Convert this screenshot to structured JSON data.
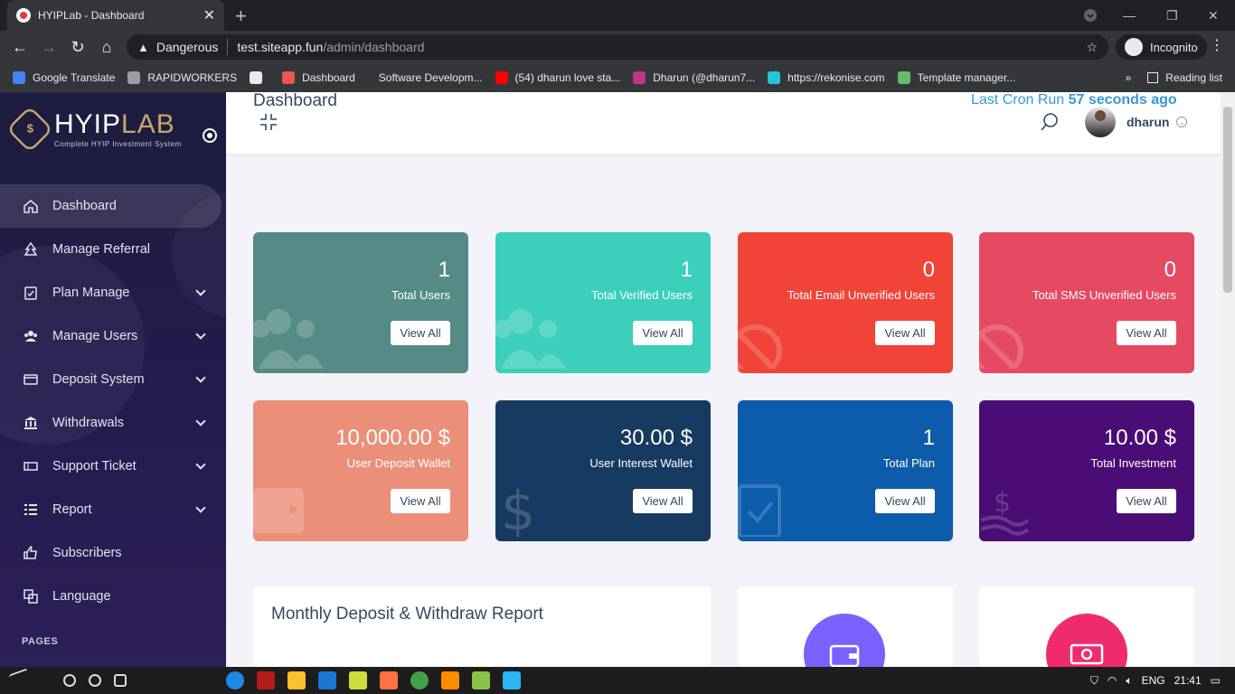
{
  "browser": {
    "tab_title": "HYIPLab - Dashboard",
    "security_label": "Dangerous",
    "url_host": "test.siteapp.fun",
    "url_path": "/admin/dashboard",
    "incognito_label": "Incognito",
    "bookmarks": [
      {
        "label": "Google Translate",
        "color": "#4285f4"
      },
      {
        "label": "RAPIDWORKERS",
        "color": "#9aa0a6"
      },
      {
        "label": "",
        "color": "#e8eaed"
      },
      {
        "label": "Dashboard",
        "color": "#ef5350"
      },
      {
        "label": "Software Developm...",
        "color": ""
      },
      {
        "label": "(54) dharun love sta...",
        "color": "#ff0000"
      },
      {
        "label": "Dharun (@dharun7...",
        "color": "#c13584"
      },
      {
        "label": "https://rekonise.com",
        "color": "#26c6da"
      },
      {
        "label": "Template manager...",
        "color": "#66bb6a"
      }
    ],
    "reading_list_label": "Reading list",
    "more_bookmarks": "»"
  },
  "sidebar": {
    "brand_main": "HYIP",
    "brand_accent": "LAB",
    "brand_tagline": "Complete HYIP Investment System",
    "items": [
      {
        "label": "Dashboard",
        "icon": "home-icon",
        "active": true,
        "has_children": false
      },
      {
        "label": "Manage Referral",
        "icon": "referral-tree-icon",
        "active": false,
        "has_children": false
      },
      {
        "label": "Plan Manage",
        "icon": "clipboard-check-icon",
        "active": false,
        "has_children": true
      },
      {
        "label": "Manage Users",
        "icon": "users-icon",
        "active": false,
        "has_children": true
      },
      {
        "label": "Deposit System",
        "icon": "credit-card-icon",
        "active": false,
        "has_children": true
      },
      {
        "label": "Withdrawals",
        "icon": "bank-icon",
        "active": false,
        "has_children": true
      },
      {
        "label": "Support Ticket",
        "icon": "ticket-icon",
        "active": false,
        "has_children": true
      },
      {
        "label": "Report",
        "icon": "list-icon",
        "active": false,
        "has_children": true
      },
      {
        "label": "Subscribers",
        "icon": "thumbs-up-icon",
        "active": false,
        "has_children": false
      },
      {
        "label": "Language",
        "icon": "language-icon",
        "active": false,
        "has_children": false
      }
    ],
    "section_label": "PAGES"
  },
  "topbar": {
    "username": "dharun"
  },
  "main": {
    "page_title": "Dashboard",
    "cron_label": "Last Cron Run",
    "cron_value": "57 seconds ago",
    "cards": [
      {
        "value": "1",
        "label": "Total Users",
        "button": "View All",
        "color": "#558b86",
        "icon": "users-bg-icon"
      },
      {
        "value": "1",
        "label": "Total Verified Users",
        "button": "View All",
        "color": "#3ccfbb",
        "icon": "users-bg-icon"
      },
      {
        "value": "0",
        "label": "Total Email Unverified Users",
        "button": "View All",
        "color": "#f04438",
        "icon": "ban-bg-icon"
      },
      {
        "value": "0",
        "label": "Total SMS Unverified Users",
        "button": "View All",
        "color": "#e64a62",
        "icon": "ban-bg-icon"
      },
      {
        "value": "10,000.00 $",
        "label": "User Deposit Wallet",
        "button": "View All",
        "color": "#ec8f78",
        "icon": "wallet-bg-icon"
      },
      {
        "value": "30.00 $",
        "label": "User Interest Wallet",
        "button": "View All",
        "color": "#173a60",
        "icon": "dollar-bg-icon"
      },
      {
        "value": "1",
        "label": "Total Plan",
        "button": "View All",
        "color": "#0d5cab",
        "icon": "clipboard-check-bg-icon"
      },
      {
        "value": "10.00 $",
        "label": "Total Investment",
        "button": "View All",
        "color": "#4a0d75",
        "icon": "hand-dollar-bg-icon"
      }
    ],
    "report_title": "Monthly Deposit & Withdraw Report",
    "widgets": [
      {
        "icon": "wallet-icon",
        "color": "#7b61ff"
      },
      {
        "icon": "money-bill-icon",
        "color": "#ef2b6c"
      }
    ]
  },
  "taskbar": {
    "language": "ENG",
    "time": "21:41"
  }
}
